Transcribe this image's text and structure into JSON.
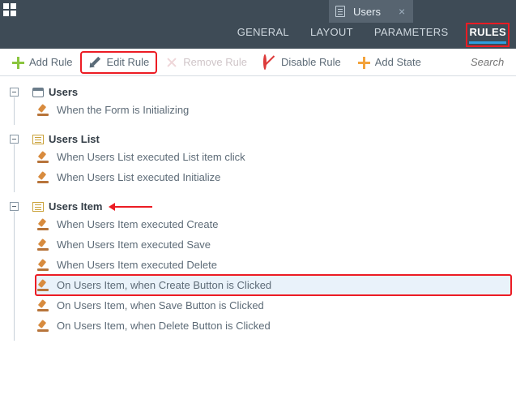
{
  "header": {
    "active_doc": "Users",
    "tabs": {
      "general": "GENERAL",
      "layout": "LAYOUT",
      "parameters": "PARAMETERS",
      "rules": "RULES"
    }
  },
  "toolbar": {
    "add_rule": "Add Rule",
    "edit_rule": "Edit Rule",
    "remove_rule": "Remove Rule",
    "disable_rule": "Disable Rule",
    "add_state": "Add State",
    "search_placeholder": "Search"
  },
  "groups": [
    {
      "title": "Users",
      "icon": "form",
      "callout": false,
      "rules": [
        {
          "label": "When the Form is Initializing",
          "selected": false
        }
      ]
    },
    {
      "title": "Users List",
      "icon": "list",
      "callout": false,
      "rules": [
        {
          "label": "When Users List executed List item click",
          "selected": false
        },
        {
          "label": "When Users List executed Initialize",
          "selected": false
        }
      ]
    },
    {
      "title": "Users Item",
      "icon": "list",
      "callout": true,
      "rules": [
        {
          "label": "When Users Item executed Create",
          "selected": false
        },
        {
          "label": "When Users Item executed Save",
          "selected": false
        },
        {
          "label": "When Users Item executed Delete",
          "selected": false
        },
        {
          "label": "On Users Item, when Create Button is Clicked",
          "selected": true
        },
        {
          "label": "On Users Item, when Save Button is Clicked",
          "selected": false
        },
        {
          "label": "On Users Item, when Delete Button is Clicked",
          "selected": false
        }
      ]
    }
  ]
}
